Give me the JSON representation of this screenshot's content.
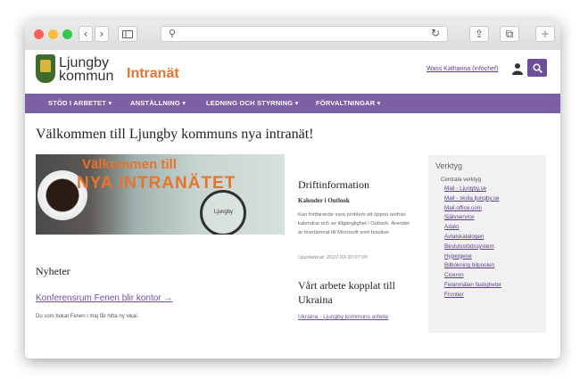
{
  "site": {
    "logo_line1": "Ljungby",
    "logo_line2": "kommun",
    "intranet_label": "Intranät",
    "user_link": "Wass Katharina (infochef)"
  },
  "nav": {
    "items": [
      "STÖD I ARBETET",
      "ANSTÄLLNING",
      "LEDNING OCH STYRNING",
      "FÖRVALTNINGAR"
    ]
  },
  "main": {
    "welcome_title": "Välkommen till Ljungby kommuns nya intranät!",
    "hero_line1": "Välkommen till",
    "hero_line2": "NYA INTRANÄTET",
    "hero_map_label": "Ljungby",
    "nyheter_heading": "Nyheter",
    "news_link": "Konferensrum Fenen blir kontor →",
    "news_desc": "Du som bokat Fenen i maj får hitta ny lokal."
  },
  "drift": {
    "heading": "Driftinformation",
    "subheading": "Kalender i Outlook",
    "body": "Kan fortfarande vara problem att öppna andras kalendrar och se tillgänglighet i Outlook. Ärendet är överlämnat till Microsoft som felsöker",
    "updated": "Uppdaterat: 2022-03-30 07:00"
  },
  "ukraina": {
    "heading": "Vårt arbete kopplat till Ukraina",
    "link": "Ukraina - Ljungby kommuns arbete"
  },
  "tools": {
    "heading": "Verktyg",
    "subheading": "Centrala verktyg",
    "items": [
      "Mail - Ljungby.se",
      "Mail - skola.ljungby.se",
      "Mail.office.com",
      "Självservice",
      "Adato",
      "Avtalskatalogen",
      "Beslutsstödssystem",
      "Hypergene",
      "Bilbokning bilpoolen",
      "Ciceron",
      "Felanmälan fastigheter",
      "Frontier"
    ]
  },
  "colors": {
    "brand_purple": "#7d5fa5",
    "accent_orange": "#e8742c"
  }
}
